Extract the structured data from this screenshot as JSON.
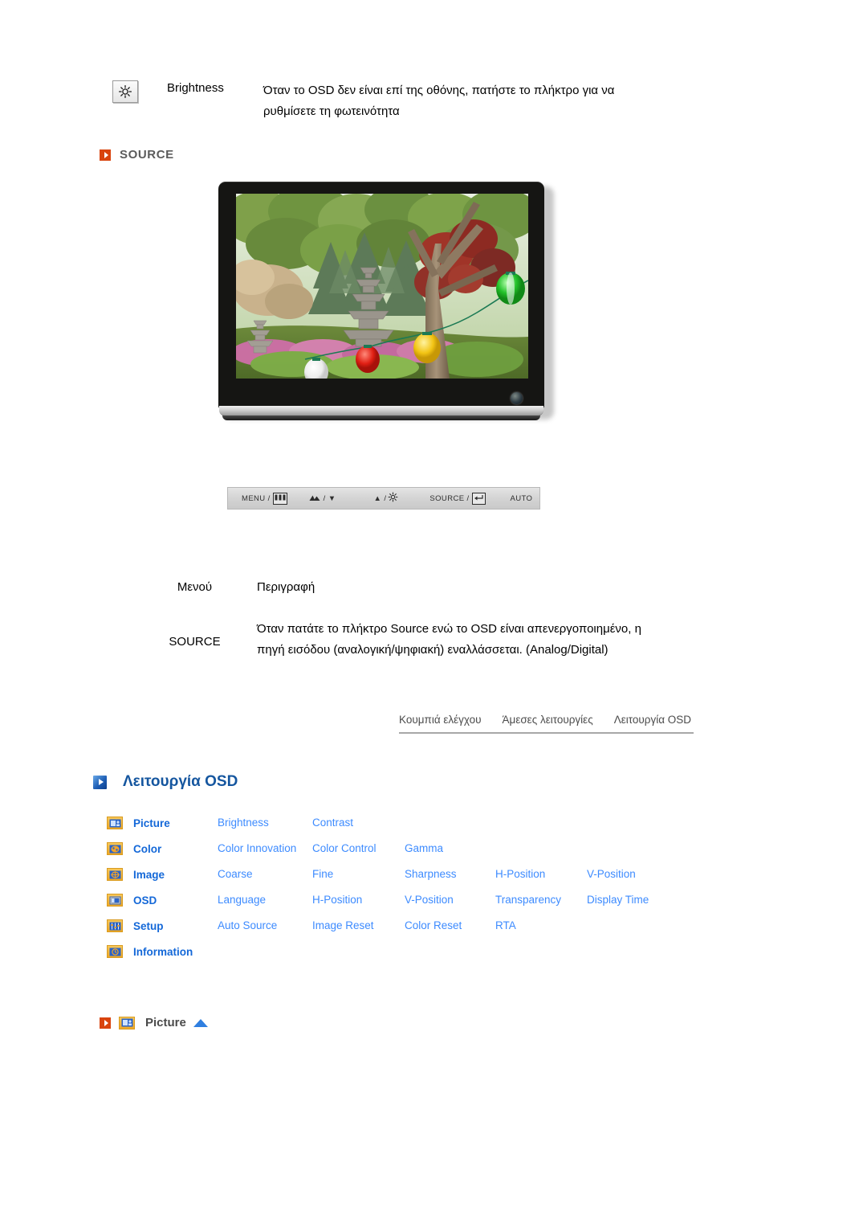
{
  "brightness": {
    "icon": "brightness-sun-icon",
    "label": "Brightness",
    "description": "Όταν το OSD δεν είναι επί της οθόνης, πατήστε το πλήκτρο για να ρυθμίσετε τη φωτεινότητα"
  },
  "source_section": {
    "bullet_icon": "orange-triangle-bullet-icon",
    "heading": "SOURCE",
    "heading_color": "#5b5b5b",
    "bullet_color": "#d9440e"
  },
  "monitor": {
    "alt": "LCD monitor displaying a garden photograph with a stone pagoda, trees and paper lanterns",
    "power_led": "power-indicator"
  },
  "control_bar": {
    "items": [
      {
        "label": "MENU /",
        "glyph": "menu-grid-icon"
      },
      {
        "label": "/",
        "glyph": "mountain-contrast-icon",
        "after": "▼"
      },
      {
        "label": "▲ /",
        "glyph": "brightness-sun-icon"
      },
      {
        "label": "SOURCE /",
        "glyph": "enter-return-icon"
      },
      {
        "label": "AUTO",
        "glyph": ""
      }
    ],
    "menu_label": "MENU /",
    "down_label": "▼",
    "up_label": "▲ /",
    "source_label": "SOURCE /",
    "auto_label": "AUTO"
  },
  "description_table": {
    "header_menu": "Μενού",
    "header_description": "Περιγραφή",
    "row_label": "SOURCE",
    "row_description": "Όταν πατάτε το πλήκτρο Source ενώ το OSD είναι απενεργοποιημένο, η πηγή εισόδου (αναλογική/ψηφιακή) εναλλάσσεται. (Analog/Digital)"
  },
  "tabs": [
    {
      "label": "Κουμπιά ελέγχου"
    },
    {
      "label": "Άμεσες λειτουργίες"
    },
    {
      "label": "Λειτουργία OSD"
    }
  ],
  "osd_section": {
    "bullet_icon": "blue-triangle-bullet-icon",
    "heading": "Λειτουργία OSD",
    "heading_color": "#15569f"
  },
  "osd_menu": {
    "rows": [
      {
        "icon": "picture-icon",
        "category": "Picture",
        "items": [
          "Brightness",
          "Contrast",
          "",
          "",
          ""
        ]
      },
      {
        "icon": "color-palette-icon",
        "category": "Color",
        "items": [
          "Color Innovation",
          "Color Control",
          "Gamma",
          "",
          ""
        ]
      },
      {
        "icon": "image-adjust-icon",
        "category": "Image",
        "items": [
          "Coarse",
          "Fine",
          "Sharpness",
          "H-Position",
          "V-Position"
        ]
      },
      {
        "icon": "osd-window-icon",
        "category": "OSD",
        "items": [
          "Language",
          "H-Position",
          "V-Position",
          "Transparency",
          "Display Time"
        ]
      },
      {
        "icon": "setup-sliders-icon",
        "category": "Setup",
        "items": [
          "Auto Source",
          "Image Reset",
          "Color Reset",
          "RTA",
          ""
        ]
      },
      {
        "icon": "information-clock-icon",
        "category": "Information",
        "items": [
          "",
          "",
          "",
          "",
          ""
        ]
      }
    ]
  },
  "picture_footer": {
    "bullet_icon": "orange-triangle-bullet-icon",
    "menu_icon": "picture-icon",
    "label": "Picture",
    "up_arrow_icon": "blue-up-triangle-icon"
  }
}
